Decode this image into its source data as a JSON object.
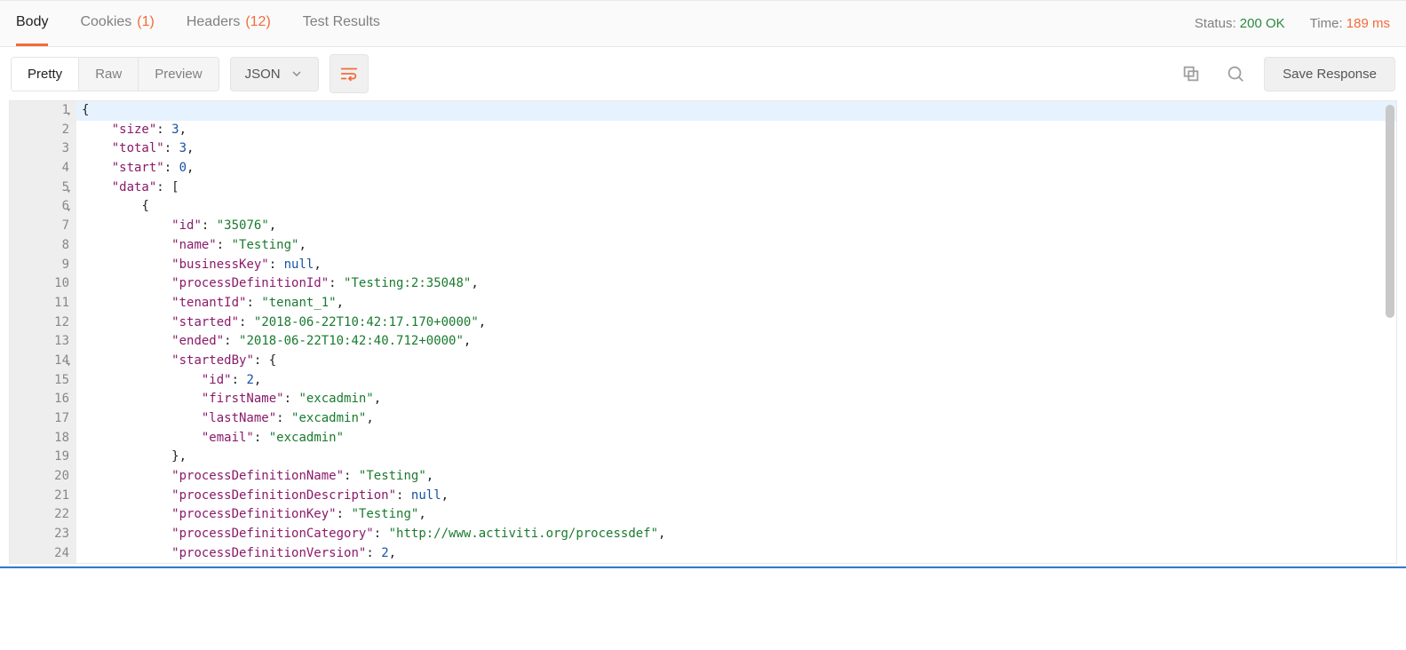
{
  "tabs": {
    "body": "Body",
    "cookies": "Cookies",
    "cookies_count": "(1)",
    "headers": "Headers",
    "headers_count": "(12)",
    "tests": "Test Results"
  },
  "status": {
    "status_label": "Status:",
    "status_value": "200 OK",
    "time_label": "Time:",
    "time_value": "189 ms"
  },
  "view_modes": {
    "pretty": "Pretty",
    "raw": "Raw",
    "preview": "Preview"
  },
  "lang_select": "JSON",
  "save_label": "Save Response",
  "gutter": [
    "1",
    "2",
    "3",
    "4",
    "5",
    "6",
    "7",
    "8",
    "9",
    "10",
    "11",
    "12",
    "13",
    "14",
    "15",
    "16",
    "17",
    "18",
    "19",
    "20",
    "21",
    "22",
    "23",
    "24"
  ],
  "gutter_folds": [
    0,
    4,
    5,
    13
  ],
  "json_body": {
    "size": 3,
    "total": 3,
    "start": 0,
    "data": [
      {
        "id": "35076",
        "name": "Testing",
        "businessKey": null,
        "processDefinitionId": "Testing:2:35048",
        "tenantId": "tenant_1",
        "started": "2018-06-22T10:42:17.170+0000",
        "ended": "2018-06-22T10:42:40.712+0000",
        "startedBy": {
          "id": 2,
          "firstName": "excadmin",
          "lastName": "excadmin",
          "email": "excadmin"
        },
        "processDefinitionName": "Testing",
        "processDefinitionDescription": null,
        "processDefinitionKey": "Testing",
        "processDefinitionCategory": "http://www.activiti.org/processdef",
        "processDefinitionVersion": 2
      }
    ]
  },
  "code_lines": [
    "{",
    "    \"size\": 3,",
    "    \"total\": 3,",
    "    \"start\": 0,",
    "    \"data\": [",
    "        {",
    "            \"id\": \"35076\",",
    "            \"name\": \"Testing\",",
    "            \"businessKey\": null,",
    "            \"processDefinitionId\": \"Testing:2:35048\",",
    "            \"tenantId\": \"tenant_1\",",
    "            \"started\": \"2018-06-22T10:42:17.170+0000\",",
    "            \"ended\": \"2018-06-22T10:42:40.712+0000\",",
    "            \"startedBy\": {",
    "                \"id\": 2,",
    "                \"firstName\": \"excadmin\",",
    "                \"lastName\": \"excadmin\",",
    "                \"email\": \"excadmin\"",
    "            },",
    "            \"processDefinitionName\": \"Testing\",",
    "            \"processDefinitionDescription\": null,",
    "            \"processDefinitionKey\": \"Testing\",",
    "            \"processDefinitionCategory\": \"http://www.activiti.org/processdef\",",
    "            \"processDefinitionVersion\": 2,"
  ]
}
